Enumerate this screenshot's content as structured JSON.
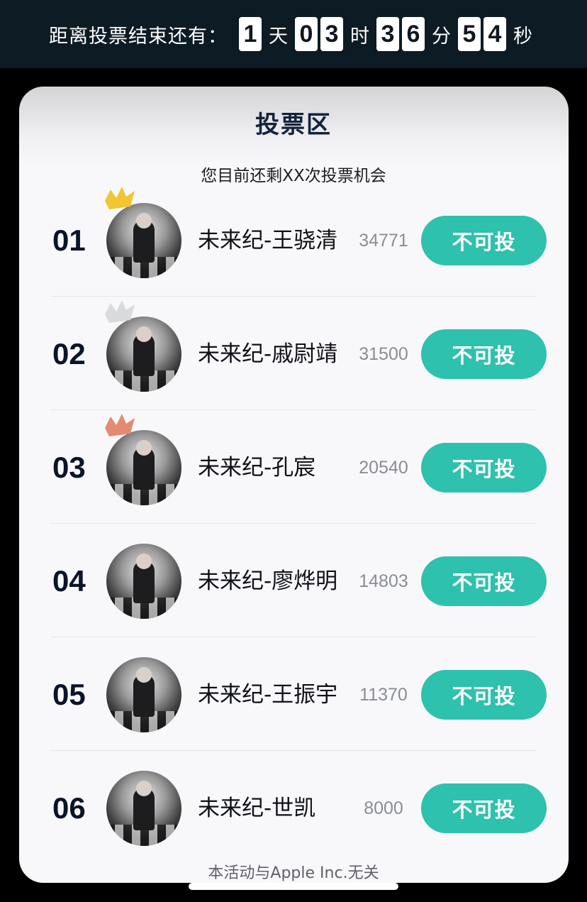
{
  "countdown": {
    "label": "距离投票结束还有：",
    "days": [
      "1"
    ],
    "days_unit": "天",
    "hours": [
      "0",
      "3"
    ],
    "hours_unit": "时",
    "minutes": [
      "3",
      "6"
    ],
    "minutes_unit": "分",
    "seconds": [
      "5",
      "4"
    ],
    "seconds_unit": "秒"
  },
  "panel": {
    "title": "投票区",
    "subtitle": "您目前还剩XX次投票机会"
  },
  "candidates": [
    {
      "rank": "01",
      "name": "未来纪-王骁清",
      "votes": "34771",
      "button": "不可投",
      "crown": "gold-crown-icon",
      "crown_color": "#f2c531"
    },
    {
      "rank": "02",
      "name": "未来纪-戚尉靖",
      "votes": "31500",
      "button": "不可投",
      "crown": "silver-crown-icon",
      "crown_color": "#d9dadc"
    },
    {
      "rank": "03",
      "name": "未来纪-孔宸",
      "votes": "20540",
      "button": "不可投",
      "crown": "bronze-crown-icon",
      "crown_color": "#e58a72"
    },
    {
      "rank": "04",
      "name": "未来纪-廖烨明",
      "votes": "14803",
      "button": "不可投"
    },
    {
      "rank": "05",
      "name": "未来纪-王振宇",
      "votes": "11370",
      "button": "不可投"
    },
    {
      "rank": "06",
      "name": "未来纪-世凯",
      "votes": "8000",
      "button": "不可投"
    }
  ],
  "footer": "本活动与Apple Inc.无关",
  "colors": {
    "accent": "#2ec1ad",
    "topbar": "#0d1b24",
    "rank_text": "#0b1428",
    "vote_text": "#8a8d96"
  }
}
